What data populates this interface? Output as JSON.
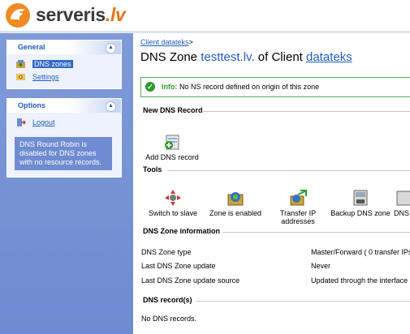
{
  "header": {
    "logo_text": "serveris",
    "logo_suffix": ".lv",
    "brand_color": "#e8741c"
  },
  "sidebar": {
    "general": {
      "title": "General",
      "items": [
        {
          "label": "DNS zones",
          "icon": "dns-zones-icon",
          "selected": true
        },
        {
          "label": "Settings",
          "icon": "settings-icon",
          "selected": false
        }
      ]
    },
    "options": {
      "title": "Options",
      "items": [
        {
          "label": "Logout",
          "icon": "logout-icon"
        }
      ],
      "note": "DNS Round Robin is disabled for DNS zones with no resource records."
    }
  },
  "main": {
    "breadcrumb": {
      "link": "Client datateks",
      "separator": ">"
    },
    "title": {
      "prefix": "DNS Zone",
      "zone": "testtest.lv.",
      "middle": "of Client",
      "client": "datateks"
    },
    "info": {
      "label": "Info:",
      "text": "No NS record defined on origin of this zone"
    },
    "new_record": {
      "heading": "New DNS Record",
      "add_label": "Add DNS record"
    },
    "tools": {
      "heading": "Tools",
      "items": [
        {
          "label": "Switch to slave",
          "icon": "switch-slave-icon"
        },
        {
          "label": "Zone is enabled",
          "icon": "zone-enabled-icon"
        },
        {
          "label_1": "Transfer IP",
          "label_2": "addresses",
          "icon": "transfer-ip-icon"
        },
        {
          "label": "Backup DNS zone",
          "icon": "backup-zone-icon"
        },
        {
          "label": "DNS",
          "icon": "dns-extra-icon"
        }
      ]
    },
    "zone_info": {
      "heading": "DNS Zone information",
      "rows": [
        {
          "key": "DNS Zone type",
          "value": "Master/Forward ( 0 transfer IPs"
        },
        {
          "key": "Last DNS Zone update",
          "value": "Never"
        },
        {
          "key": "Last DNS Zone update source",
          "value": "Updated through the interface"
        }
      ]
    },
    "records": {
      "heading": "DNS record(s)",
      "empty_text": "No DNS records."
    }
  }
}
